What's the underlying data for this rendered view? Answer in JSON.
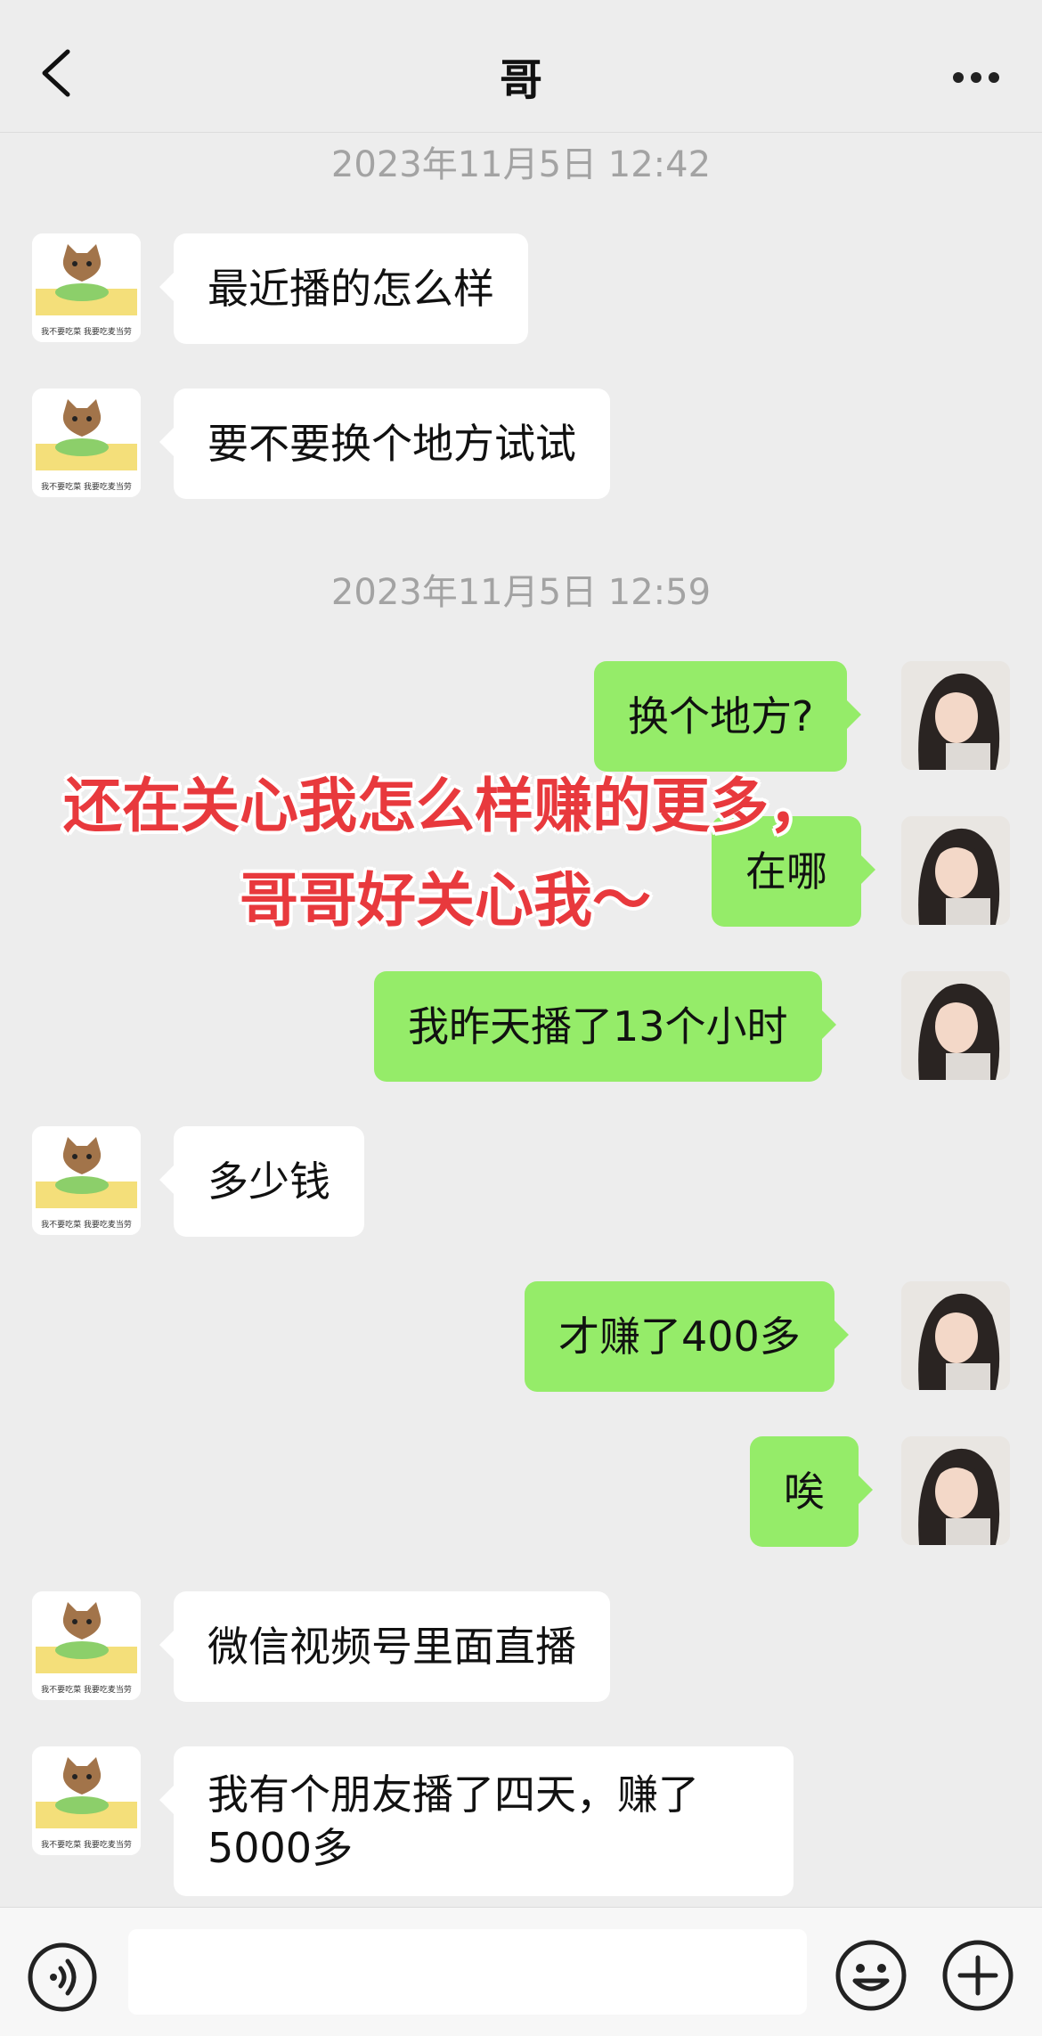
{
  "header": {
    "title": "哥"
  },
  "timestamps": [
    "2023年11月5日 12:42",
    "2023年11月5日 12:59"
  ],
  "messages": [
    {
      "side": "left",
      "text": "最近播的怎么样"
    },
    {
      "side": "left",
      "text": "要不要换个地方试试"
    },
    {
      "side": "right",
      "text": "换个地方?"
    },
    {
      "side": "right",
      "text": "在哪"
    },
    {
      "side": "right",
      "text": "我昨天播了13个小时"
    },
    {
      "side": "left",
      "text": "多少钱"
    },
    {
      "side": "right",
      "text": "才赚了400多"
    },
    {
      "side": "right",
      "text": "唉"
    },
    {
      "side": "left",
      "text": "微信视频号里面直播"
    },
    {
      "side": "left",
      "text": "我有个朋友播了四天，赚了5000多"
    }
  ],
  "overlay": {
    "line1": "还在关心我怎么样赚的更多，",
    "line2": "哥哥好关心我～"
  },
  "avatar_caption": "我不要吃菜 我要吃麦当劳",
  "icons": {
    "back": "chevron-left-icon",
    "more": "more-dots-icon",
    "voice": "voice-icon",
    "emoji": "emoji-icon",
    "plus": "plus-icon"
  },
  "colors": {
    "background": "#ededed",
    "bubble_self": "#95ec69",
    "bubble_other": "#ffffff",
    "overlay_text": "#e8393d"
  }
}
